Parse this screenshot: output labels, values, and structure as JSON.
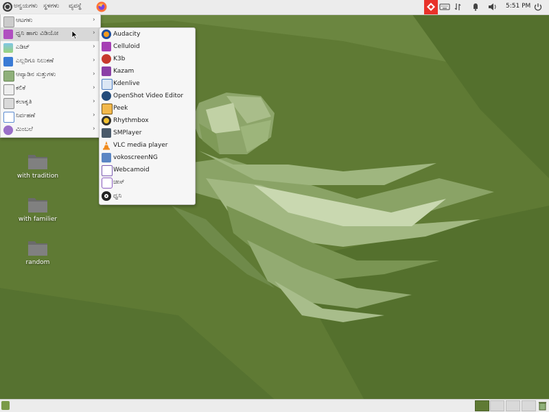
{
  "top_panel": {
    "menus": {
      "applications": "ಅನ್ವಯಗಳು",
      "places": "ಸ್ಥಳಗಳು",
      "system": "ವ್ಯವಸ್ಥೆ"
    },
    "clock": "5:51 PM",
    "tray_icons": [
      "remote-desktop-icon",
      "keyboard-icon",
      "network-icon",
      "notification-bell-icon",
      "volume-icon",
      "power-icon"
    ]
  },
  "apps_menu": {
    "categories": [
      {
        "label": "ಆಟಗಳು",
        "icon": "games-icon"
      },
      {
        "label": "ಧ್ವನಿ ಹಾಗು ವಿಡಿಯೋ",
        "icon": "sound-video-icon",
        "selected": true
      },
      {
        "label": "ಎಡಿಟ್",
        "icon": "graphics-icon"
      },
      {
        "label": "ಎಲ್ಲರಿಗೂ ನಿಲುಕಣೆ",
        "icon": "accessibility-icon"
      },
      {
        "label": "ಆಪ್ಯಾಡಿನ ಸುತ್ತುಗಳು",
        "icon": "accessories-icon"
      },
      {
        "label": "ಕಲಿಕೆ",
        "icon": "education-icon"
      },
      {
        "label": "ಕಲಾಕೃತಿ",
        "icon": "office-icon"
      },
      {
        "label": "ನಿರ್ವಹಣೆ",
        "icon": "settings-icon"
      },
      {
        "label": "ಮಿಂಬಲೆ",
        "icon": "internet-icon"
      }
    ]
  },
  "submenu": {
    "items": [
      {
        "label": "Audacity",
        "icon": "audacity-icon"
      },
      {
        "label": "Celluloid",
        "icon": "celluloid-icon"
      },
      {
        "label": "K3b",
        "icon": "k3b-icon"
      },
      {
        "label": "Kazam",
        "icon": "kazam-icon"
      },
      {
        "label": "Kdenlive",
        "icon": "kdenlive-icon"
      },
      {
        "label": "OpenShot Video Editor",
        "icon": "openshot-icon"
      },
      {
        "label": "Peek",
        "icon": "peek-icon"
      },
      {
        "label": "Rhythmbox",
        "icon": "rhythmbox-icon"
      },
      {
        "label": "SMPlayer",
        "icon": "smplayer-icon"
      },
      {
        "label": "VLC media player",
        "icon": "vlc-icon"
      },
      {
        "label": "vokoscreenNG",
        "icon": "vokoscreen-icon"
      },
      {
        "label": "Webcamoid",
        "icon": "webcamoid-icon"
      },
      {
        "label": "ಚೀಸ್",
        "icon": "cheese-icon"
      },
      {
        "label": "ಧ್ವನಿ",
        "icon": "sound-recorder-icon"
      }
    ]
  },
  "desktop": {
    "icons": [
      {
        "label": "with tradition"
      },
      {
        "label": "with familier"
      },
      {
        "label": "random"
      }
    ]
  },
  "colors": {
    "accent_green": "#5f7a34",
    "panel": "#ececec",
    "remote_red": "#e8322a"
  }
}
